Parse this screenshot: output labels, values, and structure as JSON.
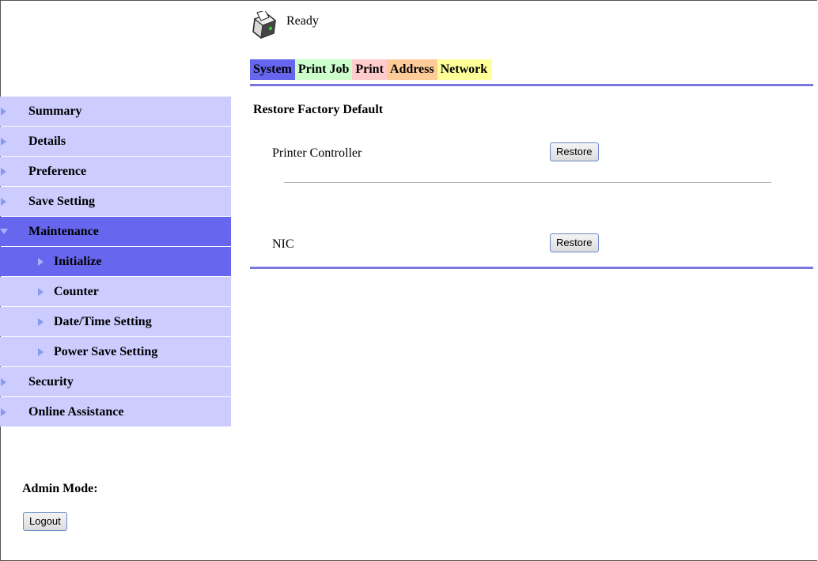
{
  "status": {
    "text": "Ready",
    "icon": "printer-icon"
  },
  "tabs": [
    {
      "label": "System",
      "color": "#6666ee"
    },
    {
      "label": "Print Job",
      "color": "#ccffcc"
    },
    {
      "label": "Print",
      "color": "#ffcccc"
    },
    {
      "label": "Address",
      "color": "#ffcc99"
    },
    {
      "label": "Network",
      "color": "#ffff99"
    }
  ],
  "sidebar": {
    "items": [
      {
        "label": "Summary"
      },
      {
        "label": "Details"
      },
      {
        "label": "Preference"
      },
      {
        "label": "Save Setting"
      },
      {
        "label": "Maintenance",
        "expanded": true
      },
      {
        "label": "Initialize",
        "active": true
      },
      {
        "label": "Counter"
      },
      {
        "label": "Date/Time Setting"
      },
      {
        "label": "Power Save Setting"
      },
      {
        "label": "Security"
      },
      {
        "label": "Online Assistance"
      }
    ],
    "admin_label": "Admin Mode:",
    "logout_label": "Logout"
  },
  "main": {
    "title": "Restore Factory Default",
    "rows": [
      {
        "label": "Printer Controller",
        "button": "Restore"
      },
      {
        "label": "NIC",
        "button": "Restore"
      }
    ]
  },
  "colors": {
    "accent": "#6666ee",
    "nav_bg": "#ccccff",
    "rule": "#7777dd"
  }
}
